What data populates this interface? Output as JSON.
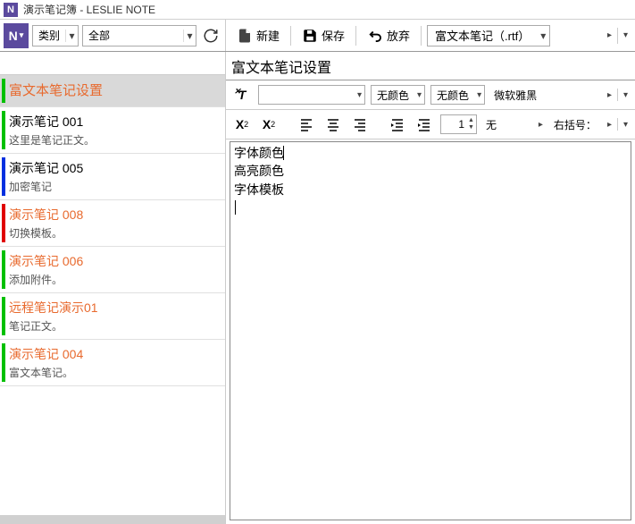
{
  "window": {
    "title": "演示笔记簿 - LESLIE NOTE"
  },
  "topbar": {
    "category_label": "类别",
    "filter_label": "全部",
    "new_label": "新建",
    "save_label": "保存",
    "discard_label": "放弃",
    "format_label": "富文本笔记（.rtf）"
  },
  "sidebar": {
    "notes": [
      {
        "title": "富文本笔记设置",
        "desc": "",
        "color": "green",
        "selected": true,
        "orange": true
      },
      {
        "title": "演示笔记 001",
        "desc": "这里是笔记正文。",
        "color": "green",
        "selected": false,
        "orange": false
      },
      {
        "title": "演示笔记 005",
        "desc": "加密笔记",
        "color": "blue",
        "selected": false,
        "orange": false
      },
      {
        "title": "演示笔记 008",
        "desc": "切换模板。",
        "color": "red",
        "selected": false,
        "orange": true
      },
      {
        "title": "演示笔记 006",
        "desc": "添加附件。",
        "color": "green",
        "selected": false,
        "orange": true
      },
      {
        "title": "远程笔记演示01",
        "desc": "笔记正文。",
        "color": "green",
        "selected": false,
        "orange": true
      },
      {
        "title": "演示笔记 004",
        "desc": "富文本笔记。",
        "color": "green",
        "selected": false,
        "orange": true
      }
    ]
  },
  "editor": {
    "doc_title": "富文本笔记设置",
    "font_color_label": "无颜色",
    "highlight_label": "无颜色",
    "font_family": "微软雅黑",
    "spin_value": "1",
    "none_label": "无",
    "right_bracket_label": "右括号：",
    "lines": [
      "字体颜色",
      "高亮颜色",
      "字体模板"
    ]
  }
}
